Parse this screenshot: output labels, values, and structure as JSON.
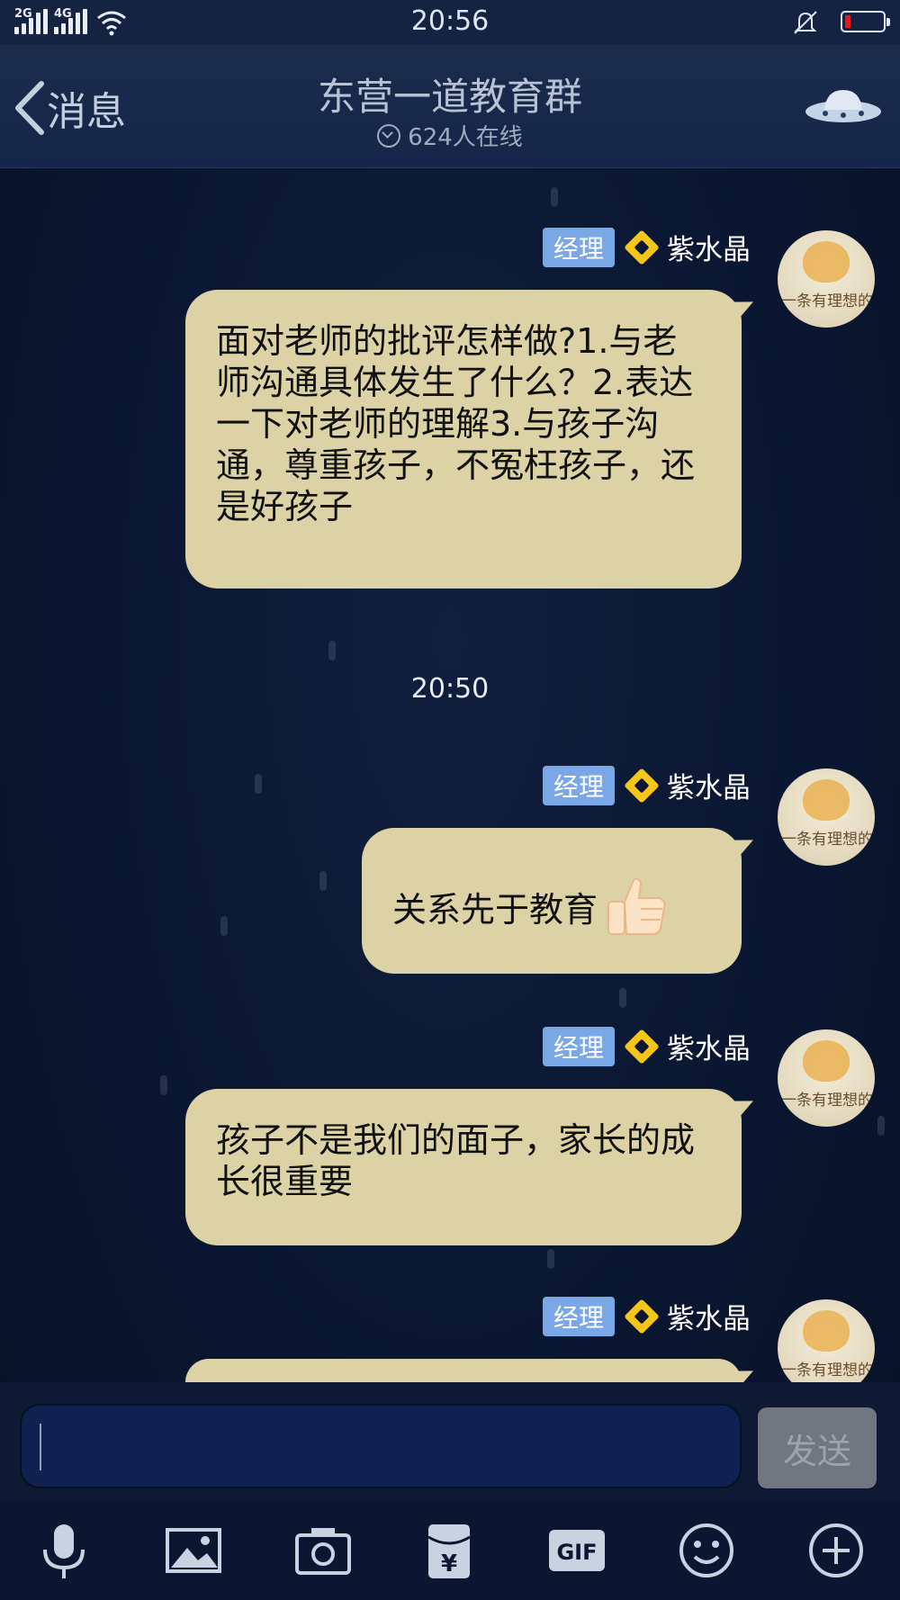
{
  "status_bar": {
    "signal1_label": "2G",
    "signal2_label": "4G",
    "time": "20:56"
  },
  "header": {
    "back_label": "消息",
    "title": "东营一道教育群",
    "online_text": "624人在线"
  },
  "messages": [
    {
      "badge": "经理",
      "sender": "紫水晶",
      "text": "面对老师的批评怎样做?1.与老师沟通具体发生了什么？2.表达一下对老师的理解3.与孩子沟通，尊重孩子，不冤枉孩子，还是好孩子"
    },
    {
      "badge": "经理",
      "sender": "紫水晶",
      "text": "关系先于教育"
    },
    {
      "badge": "经理",
      "sender": "紫水晶",
      "text": "孩子不是我们的面子，家长的成长很重要"
    },
    {
      "badge": "经理",
      "sender": "紫水晶",
      "text": ""
    }
  ],
  "timestamp_divider": "20:50",
  "avatar_caption": "一条有理想的咸鱼",
  "input": {
    "placeholder": "",
    "send_label": "发送"
  },
  "toolbar": {
    "gif_label": "GIF",
    "yuan_label": "¥",
    "icons": [
      "microphone-icon",
      "image-icon",
      "camera-icon",
      "red-packet-icon",
      "gif-icon",
      "emoji-icon",
      "plus-icon"
    ]
  },
  "colors": {
    "bubble": "#dcd2a6",
    "badge": "#7aa8e6",
    "diamond": "#f5c518",
    "background": "#0b1730"
  }
}
